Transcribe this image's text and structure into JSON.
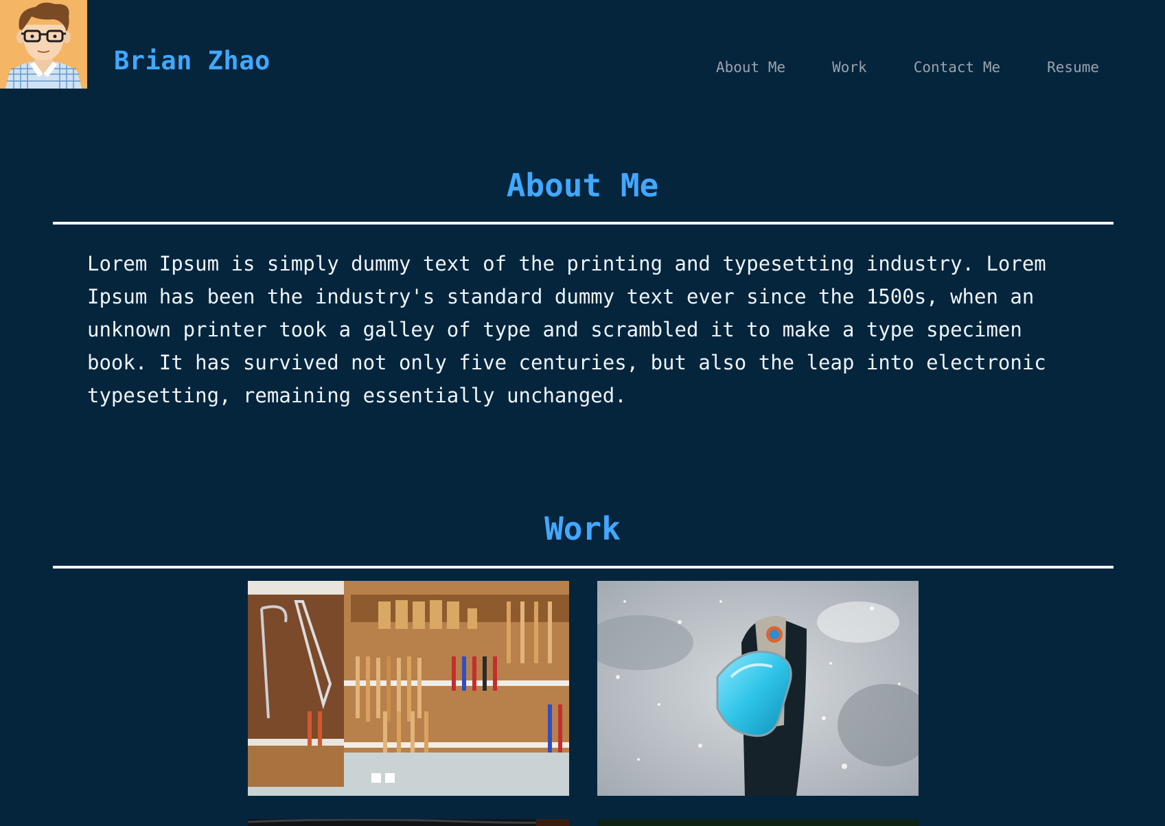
{
  "header": {
    "site_name": "Brian Zhao",
    "avatar_icon": "developer-avatar",
    "nav": [
      {
        "label": "About Me"
      },
      {
        "label": "Work"
      },
      {
        "label": "Contact Me"
      },
      {
        "label": "Resume"
      }
    ]
  },
  "about": {
    "title": "About Me",
    "body": "Lorem Ipsum is simply dummy text of the printing and typesetting industry. Lorem Ipsum has been the industry's standard dummy text ever since the 1500s, when an unknown printer took a galley of type and scrambled it to make a type specimen book. It has survived not only five centuries, but also the leap into electronic typesetting, remaining essentially unchanged."
  },
  "work": {
    "title": "Work",
    "items": [
      {
        "image": "workshop-tools-wall"
      },
      {
        "image": "ski-goggles-in-snow"
      },
      {
        "image": "dark-photo-partial"
      },
      {
        "image": "green-photo-partial"
      }
    ]
  },
  "colors": {
    "background": "#05253d",
    "accent": "#42a8ff",
    "nav_text": "#9aa3ac",
    "body_text": "#eef4f8",
    "rule": "#ffffff",
    "avatar_bg": "#f4b565"
  }
}
